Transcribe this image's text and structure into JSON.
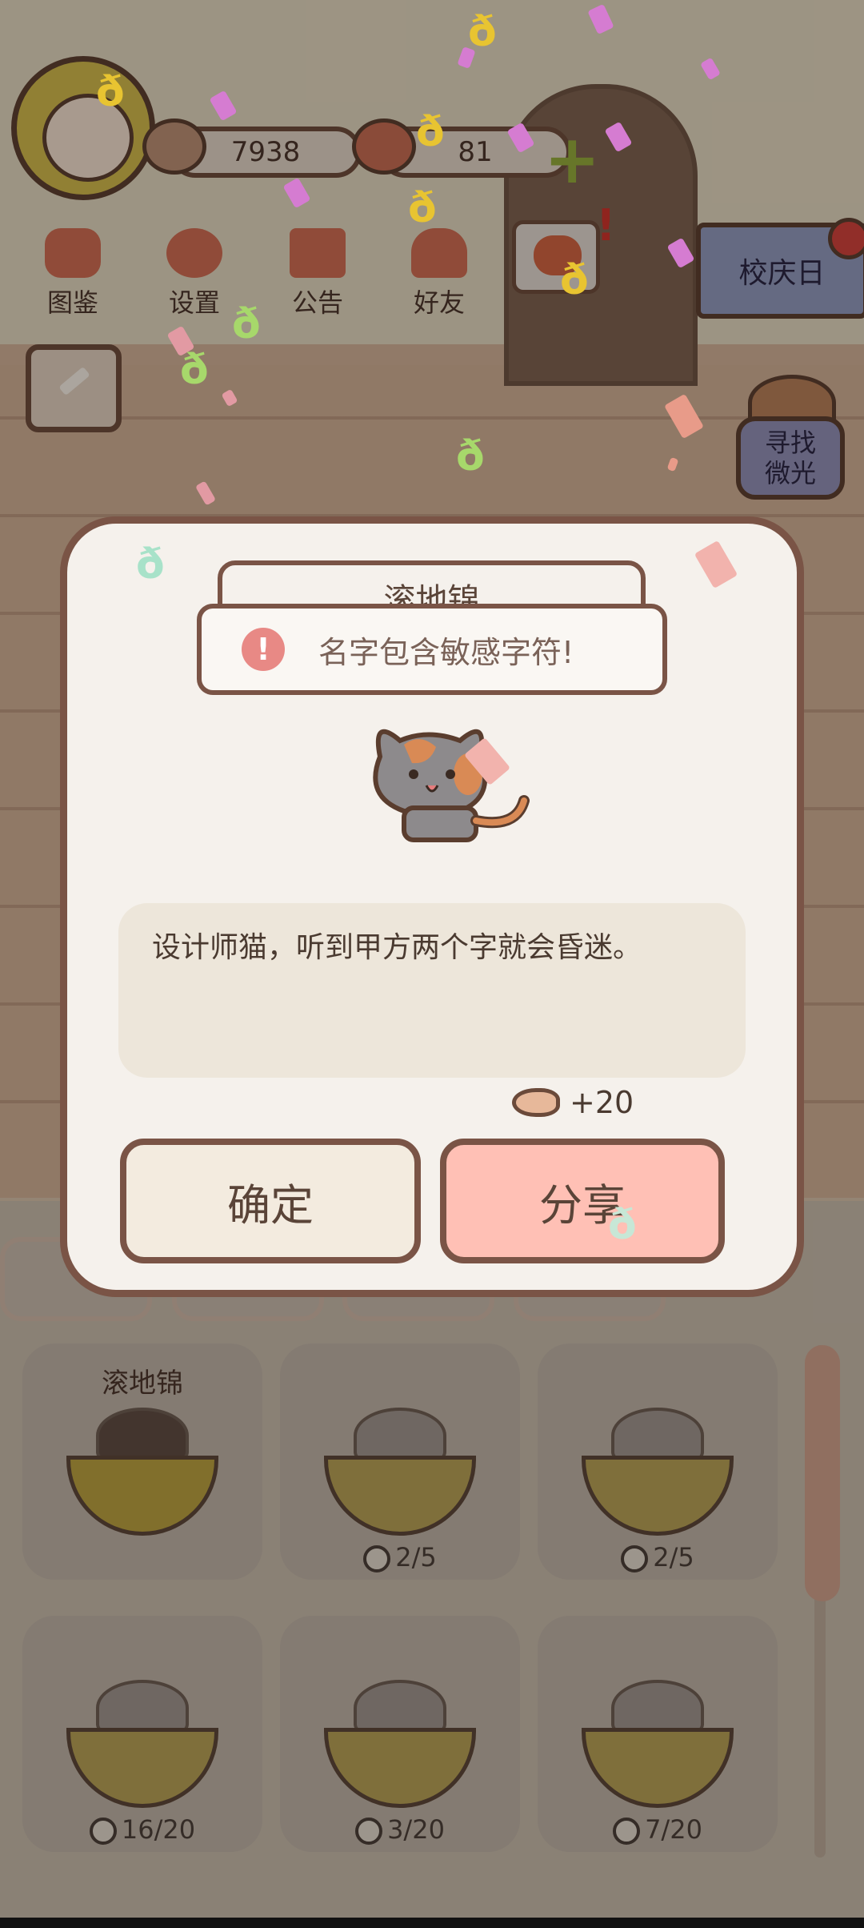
{
  "header": {
    "fish_count": "7938",
    "heart_count": "81",
    "nav": [
      {
        "label": "图鉴",
        "icon": "cat-face-icon"
      },
      {
        "label": "设置",
        "icon": "gear-icon"
      },
      {
        "label": "公告",
        "icon": "gift-icon"
      },
      {
        "label": "好友",
        "icon": "friends-icon"
      }
    ],
    "event_banner": "校庆日",
    "find_button": [
      "寻找",
      "微光"
    ]
  },
  "dialog": {
    "name_value": "滚地锦",
    "toast_message": "名字包含敏感字符!",
    "description": "设计师猫，听到甲方两个字就会昏迷。",
    "reward": "+20",
    "confirm_label": "确定",
    "share_label": "分享"
  },
  "collection": [
    {
      "name": "滚地锦",
      "progress": ""
    },
    {
      "name": "",
      "progress": "2/5"
    },
    {
      "name": "",
      "progress": "2/5"
    },
    {
      "name": "",
      "progress": "16/20"
    },
    {
      "name": "",
      "progress": "3/20"
    },
    {
      "name": "",
      "progress": "7/20"
    }
  ],
  "colors": {
    "accent_red": "#c8694f",
    "dialog_bg": "#f5f1ec",
    "share_button": "#ffc0b5",
    "border_brown": "#7a5446"
  }
}
